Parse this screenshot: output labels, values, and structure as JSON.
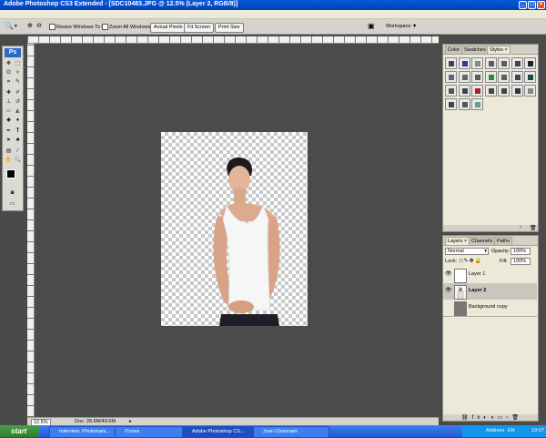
{
  "window": {
    "title": "Adobe Photoshop CS3 Extended - [SDC10483.JPG @ 12.5% (Layer 2, RGB/8)]"
  },
  "options_bar": {
    "resize_windows_label": "Resize Windows To Fit",
    "zoom_all_windows_label": "Zoom All Windows",
    "actual_pixels_label": "Actual Pixels",
    "fit_screen_label": "Fit Screen",
    "print_size_label": "Print Size",
    "workspace_label": "Workspace ▼"
  },
  "toolbox": {
    "logo": "Ps"
  },
  "status_bar": {
    "zoom": "12.5%",
    "doc_info": "Doc: 28.6M/49.6M"
  },
  "styles_panel": {
    "tabs": [
      "Color",
      "Swatches",
      "Styles ×"
    ],
    "swatch_colors": [
      "#444444",
      "#2a3a9a",
      "#888888",
      "#5a5a5a",
      "#5a5a5a",
      "#444444",
      "#222222",
      "#666666",
      "#666666",
      "#5a5a5a",
      "#2a8a3a",
      "#556655",
      "#444444",
      "#1a4a4a",
      "#555555",
      "#444444",
      "#aa2222",
      "#444444",
      "#444444",
      "#333333",
      "#888888",
      "#444444",
      "#555555",
      "#669999"
    ]
  },
  "layers_panel": {
    "tabs": [
      "Layers ×",
      "Channels",
      "Paths"
    ],
    "blend_mode": "Normal",
    "opacity_label": "Opacity:",
    "opacity_value": "100%",
    "lock_label": "Lock:",
    "fill_label": "Fill:",
    "fill_value": "100%",
    "layers": [
      {
        "name": "Layer 1",
        "visible": true,
        "selected": false
      },
      {
        "name": "Layer 2",
        "visible": true,
        "selected": true
      },
      {
        "name": "Background copy",
        "visible": false,
        "selected": false
      }
    ]
  },
  "taskbar": {
    "start_label": "start",
    "tasks": [
      "Interview: Photomani...",
      "iTunes",
      "Adobe Photoshop CS...",
      "Joan Charmant"
    ],
    "address_label": "Address",
    "language": "EN",
    "clock": "19:37"
  }
}
